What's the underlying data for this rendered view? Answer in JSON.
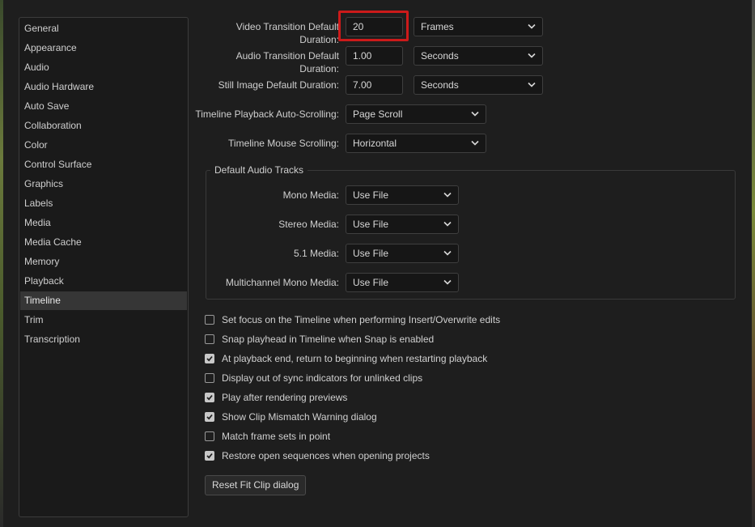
{
  "sidebar": {
    "items": [
      {
        "label": "General"
      },
      {
        "label": "Appearance"
      },
      {
        "label": "Audio"
      },
      {
        "label": "Audio Hardware"
      },
      {
        "label": "Auto Save"
      },
      {
        "label": "Collaboration"
      },
      {
        "label": "Color"
      },
      {
        "label": "Control Surface"
      },
      {
        "label": "Graphics"
      },
      {
        "label": "Labels"
      },
      {
        "label": "Media"
      },
      {
        "label": "Media Cache"
      },
      {
        "label": "Memory"
      },
      {
        "label": "Playback"
      },
      {
        "label": "Timeline",
        "selected": true
      },
      {
        "label": "Trim"
      },
      {
        "label": "Transcription"
      }
    ]
  },
  "settings": {
    "video_transition": {
      "label": "Video Transition Default Duration:",
      "value": "20",
      "unit": "Frames"
    },
    "audio_transition": {
      "label": "Audio Transition Default Duration:",
      "value": "1.00",
      "unit": "Seconds"
    },
    "still_image": {
      "label": "Still Image Default Duration:",
      "value": "7.00",
      "unit": "Seconds"
    },
    "auto_scrolling": {
      "label": "Timeline Playback Auto-Scrolling:",
      "value": "Page Scroll"
    },
    "mouse_scrolling": {
      "label": "Timeline Mouse Scrolling:",
      "value": "Horizontal"
    }
  },
  "audio_tracks": {
    "title": "Default Audio Tracks",
    "mono": {
      "label": "Mono Media:",
      "value": "Use File"
    },
    "stereo": {
      "label": "Stereo Media:",
      "value": "Use File"
    },
    "five_one": {
      "label": "5.1 Media:",
      "value": "Use File"
    },
    "multichannel": {
      "label": "Multichannel Mono Media:",
      "value": "Use File"
    }
  },
  "checkboxes": [
    {
      "label": "Set focus on the Timeline when performing Insert/Overwrite edits",
      "checked": false
    },
    {
      "label": "Snap playhead in Timeline when Snap is enabled",
      "checked": false
    },
    {
      "label": "At playback end, return to beginning when restarting playback",
      "checked": true
    },
    {
      "label": "Display out of sync indicators for unlinked clips",
      "checked": false
    },
    {
      "label": "Play after rendering previews",
      "checked": true
    },
    {
      "label": "Show Clip Mismatch Warning dialog",
      "checked": true
    },
    {
      "label": "Match frame sets in point",
      "checked": false
    },
    {
      "label": "Restore open sequences when opening projects",
      "checked": true
    }
  ],
  "reset_button": {
    "label": "Reset Fit Clip dialog"
  },
  "colors": {
    "highlight": "#cc1a1a",
    "selected_bg": "#363636",
    "panel_bg": "#1e1e1e"
  }
}
